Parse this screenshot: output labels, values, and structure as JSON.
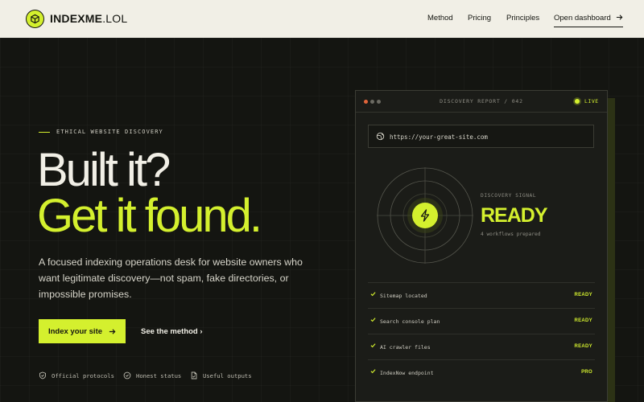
{
  "header": {
    "brand_name": "INDEXME",
    "brand_tld": ".LOL",
    "nav": [
      "Method",
      "Pricing",
      "Principles"
    ],
    "cta_label": "Open dashboard"
  },
  "hero": {
    "eyebrow": "ETHICAL WEBSITE DISCOVERY",
    "headline_line1": "Built it?",
    "headline_line2": "Get it found.",
    "lede": "A focused indexing operations desk for website owners who want legitimate discovery—not spam, fake directories, or impossible promises.",
    "primary_cta": "Index your site",
    "secondary_cta": "See the method ›",
    "trust": [
      "Official protocols",
      "Honest status",
      "Useful outputs"
    ]
  },
  "report": {
    "title": "DISCOVERY REPORT / 042",
    "live_label": "LIVE",
    "url_value": "https://your-great-site.com",
    "signal_label": "DISCOVERY SIGNAL",
    "signal_value": "READY",
    "signal_sub": "4 workflows prepared",
    "checks": [
      {
        "label": "Sitemap located",
        "status": "READY"
      },
      {
        "label": "Search console plan",
        "status": "READY"
      },
      {
        "label": "AI crawler files",
        "status": "READY"
      },
      {
        "label": "IndexNow endpoint",
        "status": "PRO"
      }
    ]
  },
  "colors": {
    "accent": "#d4f02e",
    "background": "#141511",
    "header_bg": "#f1efe6"
  },
  "icons": [
    "cube-logo-icon",
    "arrow-right-icon",
    "globe-icon",
    "bolt-icon",
    "check-icon",
    "shield-icon",
    "clock-icon",
    "file-icon"
  ]
}
